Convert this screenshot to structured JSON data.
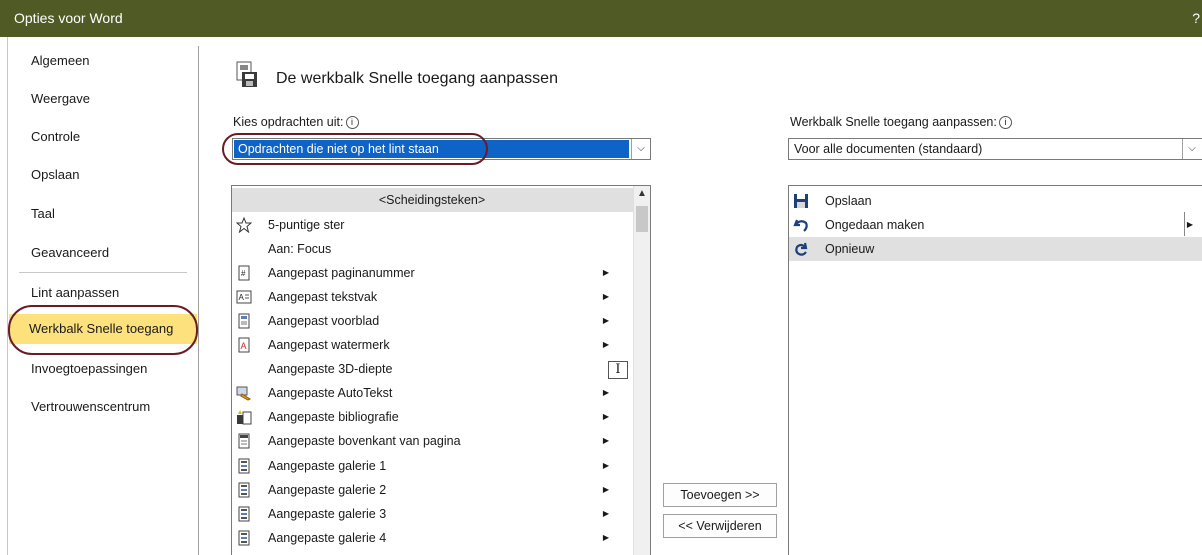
{
  "window": {
    "title": "Opties voor Word",
    "help": "?"
  },
  "sidebar": {
    "items": [
      {
        "label": "Algemeen"
      },
      {
        "label": "Weergave"
      },
      {
        "label": "Controle"
      },
      {
        "label": "Opslaan"
      },
      {
        "label": "Taal"
      },
      {
        "label": "Geavanceerd"
      },
      {
        "label": "Lint aanpassen"
      },
      {
        "label": "Werkbalk Snelle toegang"
      },
      {
        "label": "Invoegtoepassingen"
      },
      {
        "label": "Vertrouwenscentrum"
      }
    ],
    "active": "Werkbalk Snelle toegang"
  },
  "main": {
    "heading": "De werkbalk Snelle toegang aanpassen",
    "choose_label": "Kies opdrachten uit:",
    "choose_value": "Opdrachten die niet op het lint staan",
    "customize_label": "Werkbalk Snelle toegang aanpassen:",
    "customize_value": "Voor alle documenten (standaard)",
    "info_glyph": "i",
    "commands": [
      {
        "label": "<Scheidingsteken>",
        "icon": "separator",
        "submenu": false
      },
      {
        "label": "5-puntige ster",
        "icon": "star-icon",
        "submenu": false
      },
      {
        "label": "Aan: Focus",
        "icon": "",
        "submenu": false
      },
      {
        "label": "Aangepast paginanummer",
        "icon": "page-number-icon",
        "submenu": true
      },
      {
        "label": "Aangepast tekstvak",
        "icon": "textbox-icon",
        "submenu": true
      },
      {
        "label": "Aangepast voorblad",
        "icon": "cover-page-icon",
        "submenu": true
      },
      {
        "label": "Aangepast watermerk",
        "icon": "watermark-icon",
        "submenu": true
      },
      {
        "label": "Aangepaste 3D-diepte",
        "icon": "",
        "submenu": false
      },
      {
        "label": "Aangepaste AutoTekst",
        "icon": "autotext-icon",
        "submenu": true
      },
      {
        "label": "Aangepaste bibliografie",
        "icon": "bibliography-icon",
        "submenu": true
      },
      {
        "label": "Aangepaste bovenkant van pagina",
        "icon": "page-top-icon",
        "submenu": true
      },
      {
        "label": "Aangepaste galerie 1",
        "icon": "gallery-icon",
        "submenu": true
      },
      {
        "label": "Aangepaste galerie 2",
        "icon": "gallery-icon",
        "submenu": true
      },
      {
        "label": "Aangepaste galerie 3",
        "icon": "gallery-icon",
        "submenu": true
      },
      {
        "label": "Aangepaste galerie 4",
        "icon": "gallery-icon",
        "submenu": true
      }
    ],
    "toolbar": [
      {
        "label": "Opslaan",
        "icon": "save-icon",
        "submenu": false
      },
      {
        "label": "Ongedaan maken",
        "icon": "undo-icon",
        "submenu": true
      },
      {
        "label": "Opnieuw",
        "icon": "redo-icon",
        "submenu": false
      }
    ],
    "add_label": "Toevoegen >>",
    "remove_label": "<< Verwijderen"
  },
  "colors": {
    "titlebar": "#4f5a24",
    "active_nav": "#fde17c",
    "selection": "#0e63c7",
    "annotation_oval": "#6a1c24"
  }
}
